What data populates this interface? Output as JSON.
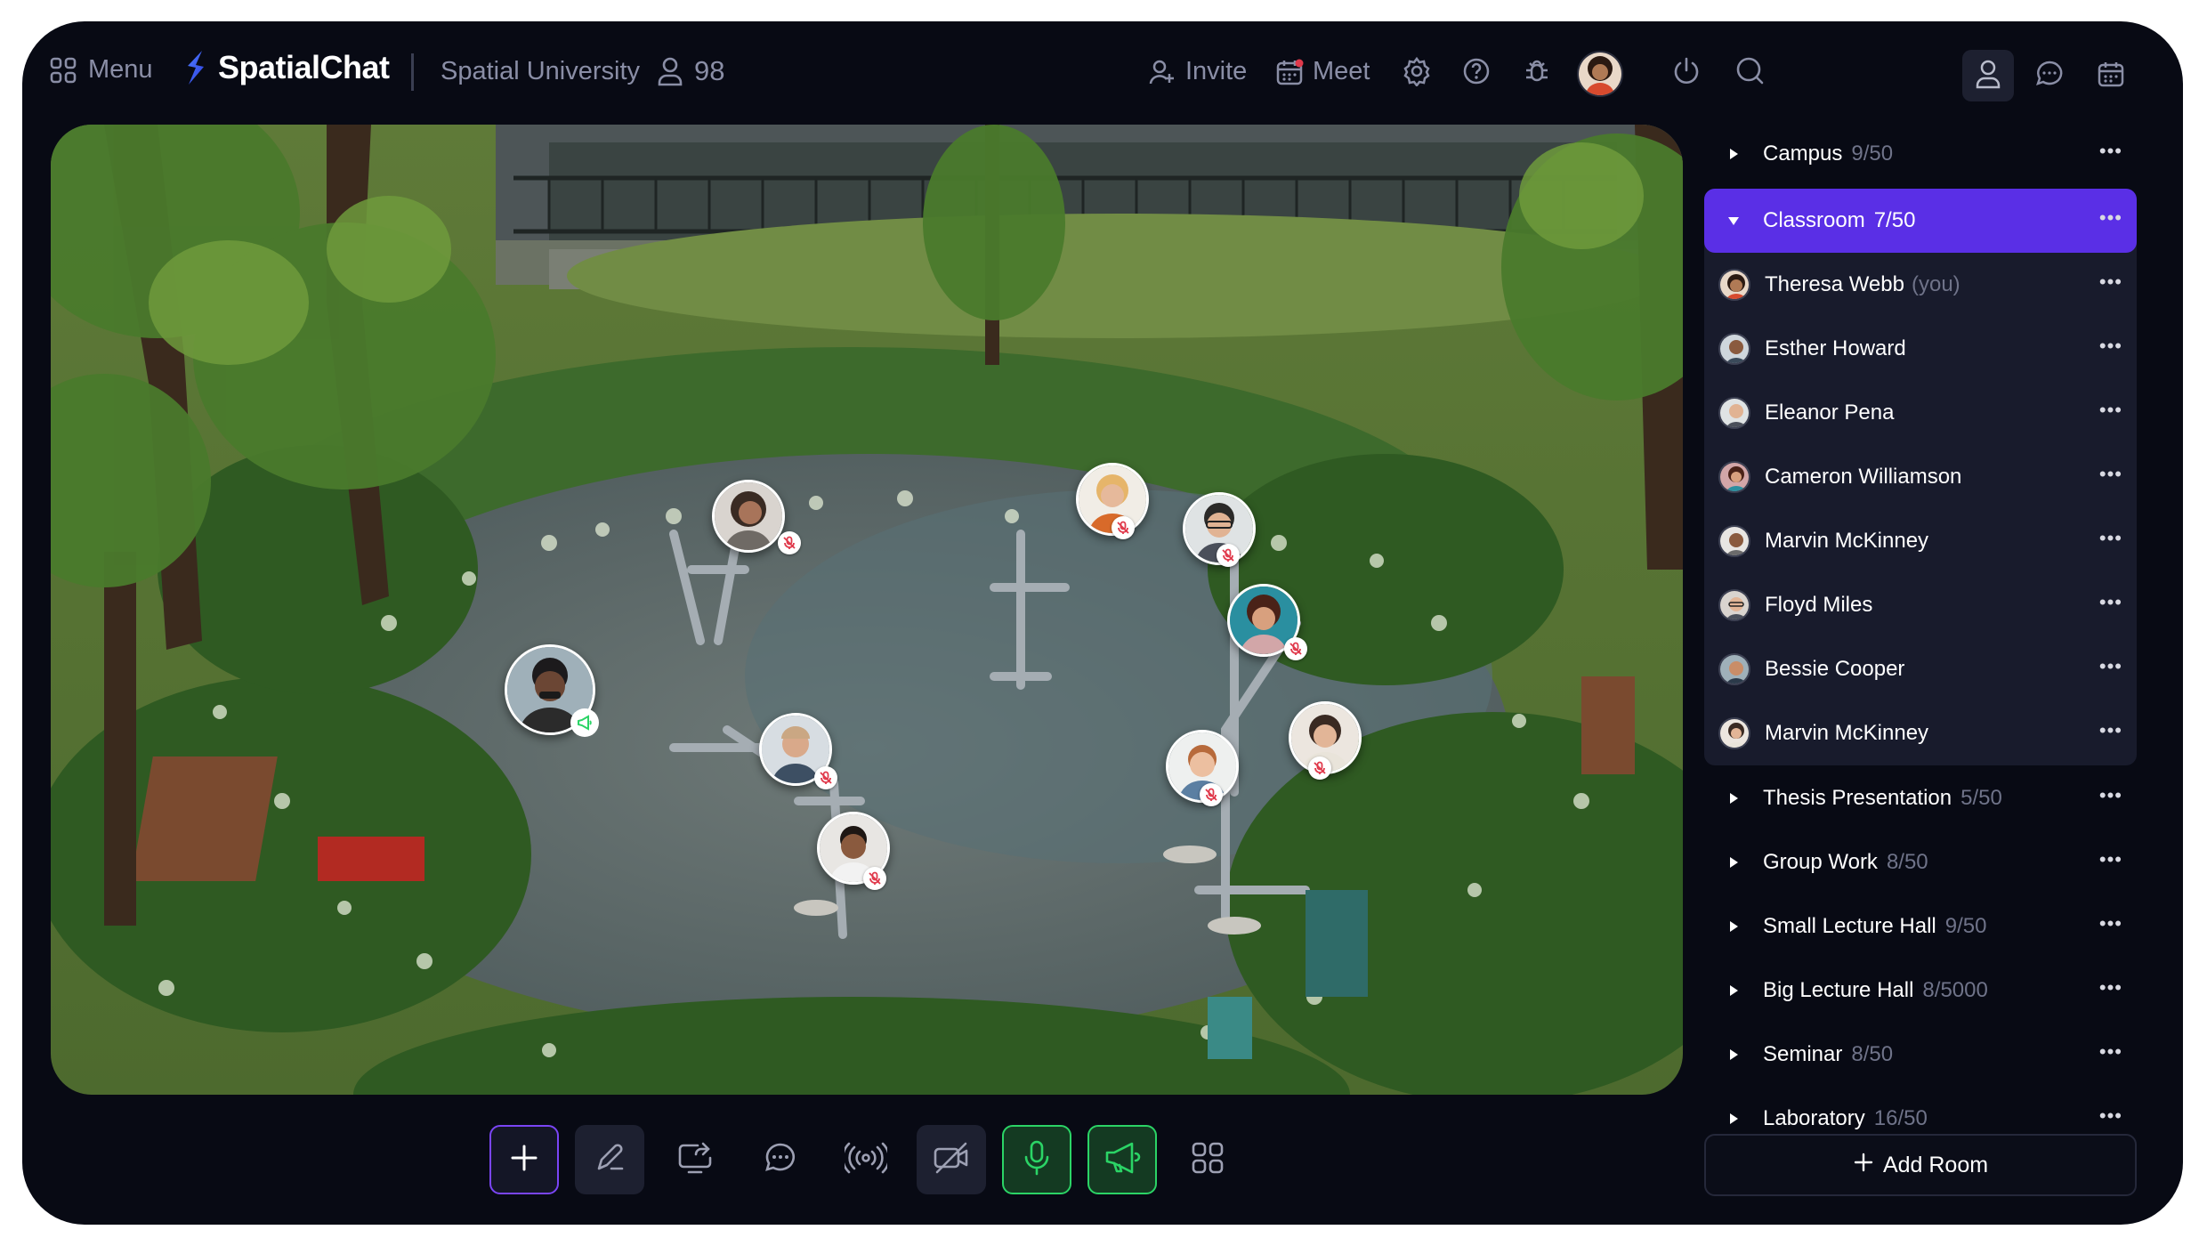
{
  "topbar": {
    "menu_label": "Menu",
    "brand": "SpatialChat",
    "space_name": "Spatial University",
    "participant_count": "98",
    "invite_label": "Invite",
    "meet_label": "Meet"
  },
  "icons": {
    "menu": "grid-icon",
    "logo": "spatialchat-logo-icon",
    "people": "person-icon",
    "invite": "add-person-icon",
    "meet": "calendar-icon",
    "settings": "gear-icon",
    "help": "help-icon",
    "bug": "bug-icon",
    "power": "power-icon",
    "search": "search-icon",
    "participants_tab": "person-icon",
    "chat_tab": "chat-icon",
    "calendar_tab": "calendar-icon"
  },
  "colors": {
    "background": "#080a14",
    "accent": "#5a2fe6",
    "mic_green": "#2bd466",
    "mute_red": "#e0394b",
    "plus_border": "#7a45f5"
  },
  "sidebar": {
    "rooms_before": [
      {
        "name": "Campus",
        "count": "9/50"
      }
    ],
    "active_room": {
      "name": "Classroom",
      "count": "7/50"
    },
    "members": [
      {
        "name": "Theresa Webb",
        "suffix": "(you)"
      },
      {
        "name": "Esther Howard",
        "suffix": ""
      },
      {
        "name": "Eleanor Pena",
        "suffix": ""
      },
      {
        "name": "Cameron Williamson",
        "suffix": ""
      },
      {
        "name": "Marvin McKinney",
        "suffix": ""
      },
      {
        "name": "Floyd Miles",
        "suffix": ""
      },
      {
        "name": "Bessie Cooper",
        "suffix": ""
      },
      {
        "name": "Marvin McKinney",
        "suffix": ""
      }
    ],
    "rooms_after": [
      {
        "name": "Thesis Presentation",
        "count": "5/50"
      },
      {
        "name": "Group Work",
        "count": "8/50"
      },
      {
        "name": "Small Lecture Hall",
        "count": "9/50"
      },
      {
        "name": "Big Lecture Hall",
        "count": "8/5000"
      },
      {
        "name": "Seminar",
        "count": "8/50"
      },
      {
        "name": "Laboratory",
        "count": "16/50"
      }
    ],
    "more_symbol": "•••",
    "add_room_label": "Add Room"
  },
  "toolbar": {
    "items": [
      "add-icon",
      "draw-icon",
      "screen-share-icon",
      "chat-icon",
      "broadcast-icon",
      "camera-off-icon",
      "microphone-icon",
      "megaphone-icon",
      "apps-grid-icon"
    ]
  }
}
